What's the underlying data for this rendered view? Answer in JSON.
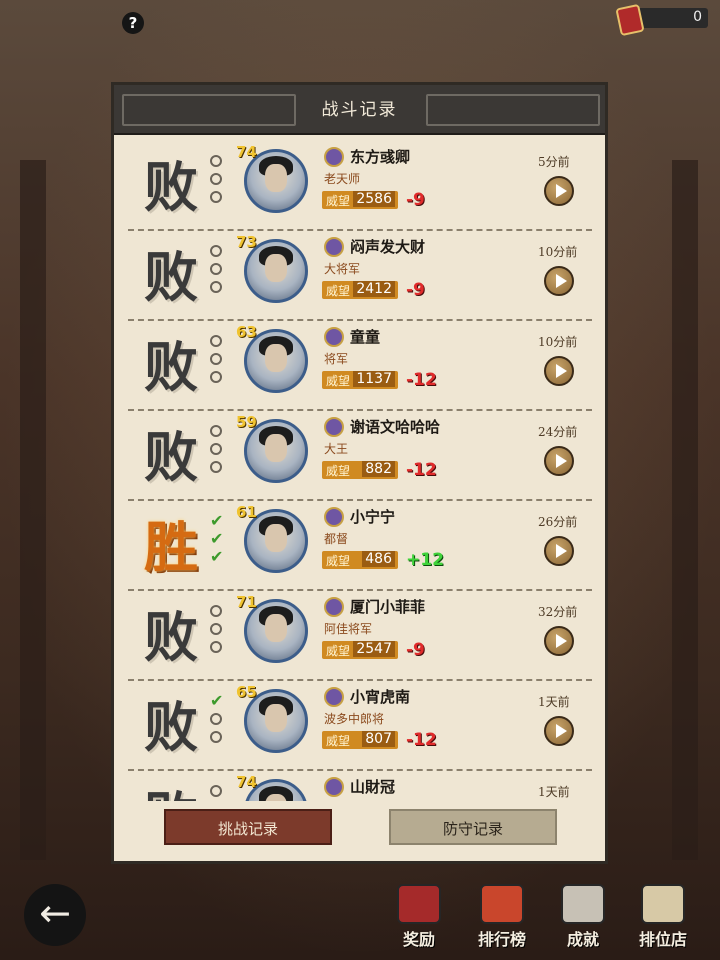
{
  "top": {
    "help": "?",
    "currency_value": "0"
  },
  "panel": {
    "title": "战斗记录",
    "records": [
      {
        "result": "败",
        "outcome": "lose",
        "checks": [
          false,
          false,
          false
        ],
        "level": "74",
        "name": "东方彧卿",
        "title": "老天师",
        "prestige_label": "威望",
        "prestige": "2586",
        "delta": "-9",
        "time": "5分前"
      },
      {
        "result": "败",
        "outcome": "lose",
        "checks": [
          false,
          false,
          false
        ],
        "level": "73",
        "name": "闷声发大财",
        "title": "大将军",
        "prestige_label": "威望",
        "prestige": "2412",
        "delta": "-9",
        "time": "10分前"
      },
      {
        "result": "败",
        "outcome": "lose",
        "checks": [
          false,
          false,
          false
        ],
        "level": "63",
        "name": "童童",
        "title": "将军",
        "prestige_label": "威望",
        "prestige": "1137",
        "delta": "-12",
        "time": "10分前"
      },
      {
        "result": "败",
        "outcome": "lose",
        "checks": [
          false,
          false,
          false
        ],
        "level": "59",
        "name": "谢语文哈哈哈",
        "title": "大王",
        "prestige_label": "威望",
        "prestige": "882",
        "delta": "-12",
        "time": "24分前"
      },
      {
        "result": "胜",
        "outcome": "win",
        "checks": [
          true,
          true,
          true
        ],
        "level": "61",
        "name": "小宁宁",
        "title": "都督",
        "prestige_label": "威望",
        "prestige": "486",
        "delta": "+12",
        "time": "26分前"
      },
      {
        "result": "败",
        "outcome": "lose",
        "checks": [
          false,
          false,
          false
        ],
        "level": "71",
        "name": "厦门小菲菲",
        "title": "阿佳将军",
        "prestige_label": "威望",
        "prestige": "2547",
        "delta": "-9",
        "time": "32分前"
      },
      {
        "result": "败",
        "outcome": "lose",
        "checks": [
          true,
          false,
          false
        ],
        "level": "65",
        "name": "小宵虎南",
        "title": "波多中郎将",
        "prestige_label": "威望",
        "prestige": "807",
        "delta": "-12",
        "time": "1天前"
      },
      {
        "result": "败",
        "outcome": "lose",
        "checks": [
          false,
          false,
          false
        ],
        "level": "74",
        "name": "山財冠",
        "title": "",
        "prestige_label": "",
        "prestige": "",
        "delta": "",
        "time": "1天前"
      }
    ],
    "tabs": {
      "challenge": "挑战记录",
      "defense": "防守记录"
    }
  },
  "bottom_nav": {
    "back": "←",
    "rewards": "奖励",
    "ranking": "排行榜",
    "achievements": "成就",
    "rank_shop": "排位店"
  }
}
